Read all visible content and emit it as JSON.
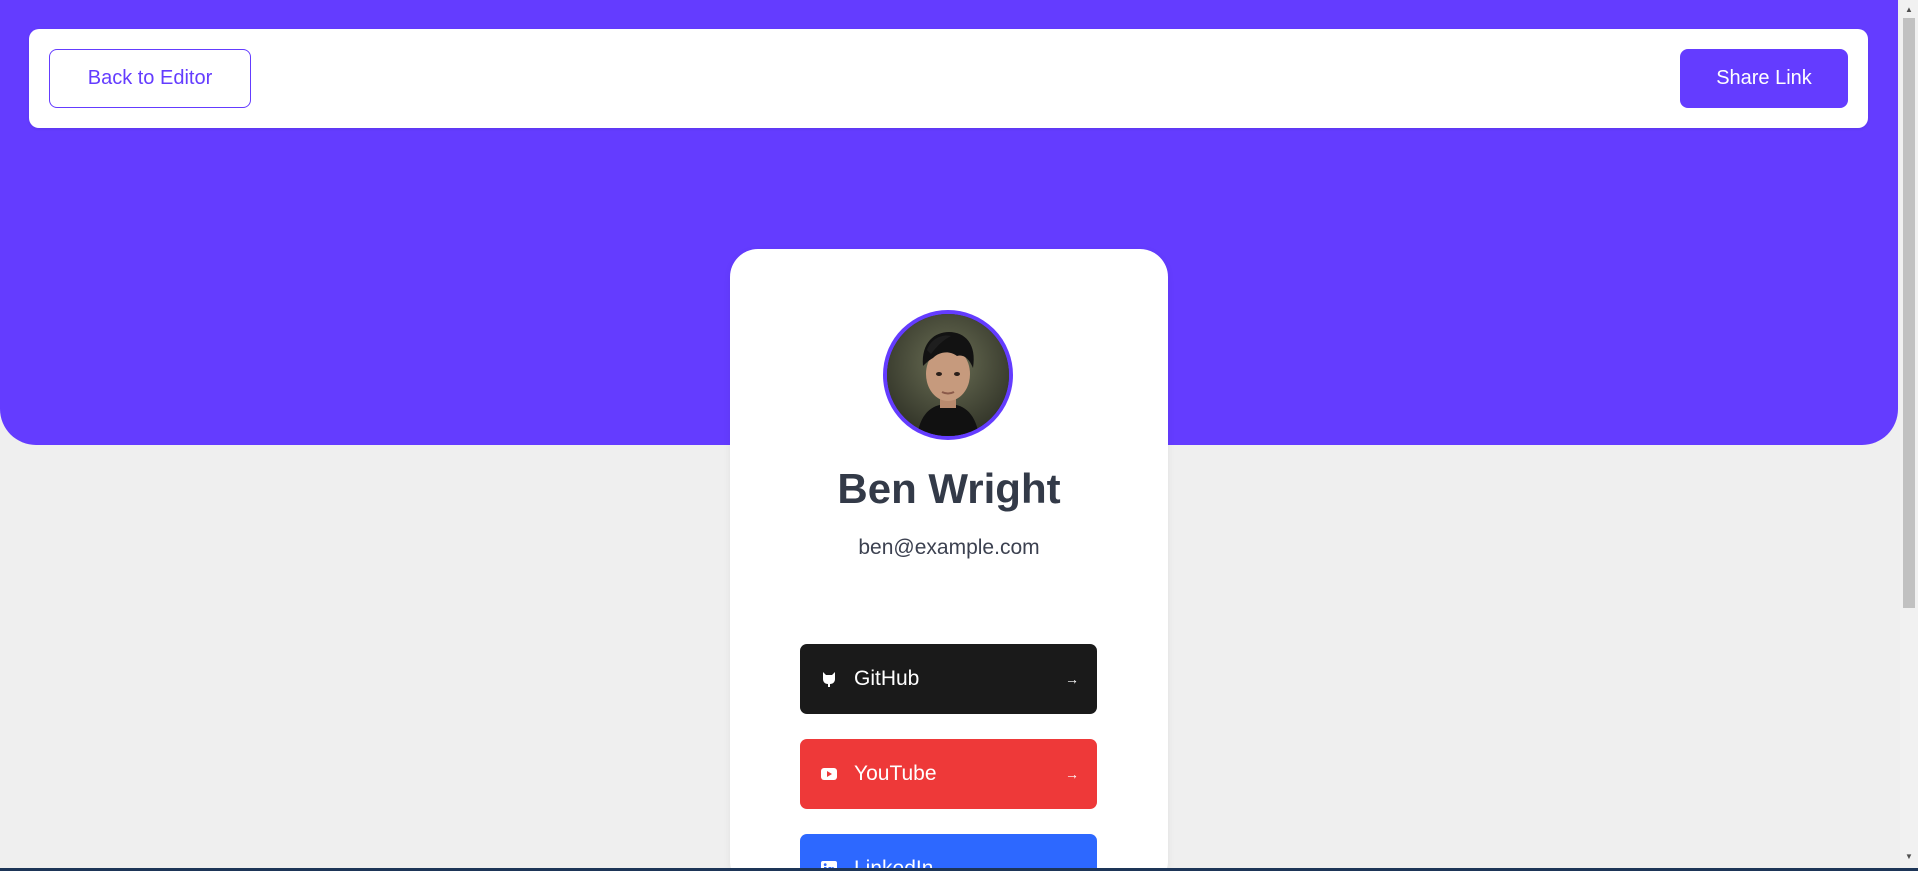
{
  "topbar": {
    "back_label": "Back to Editor",
    "share_label": "Share Link"
  },
  "profile": {
    "name": "Ben Wright",
    "email": "ben@example.com"
  },
  "links": [
    {
      "label": "GitHub",
      "color": "#1a1a1a",
      "icon": "github-icon"
    },
    {
      "label": "YouTube",
      "color": "#ee3939",
      "icon": "youtube-icon"
    },
    {
      "label": "LinkedIn",
      "color": "#2d68ff",
      "icon": "linkedin-icon"
    }
  ],
  "colors": {
    "accent": "#643cff",
    "background": "#efefef"
  }
}
